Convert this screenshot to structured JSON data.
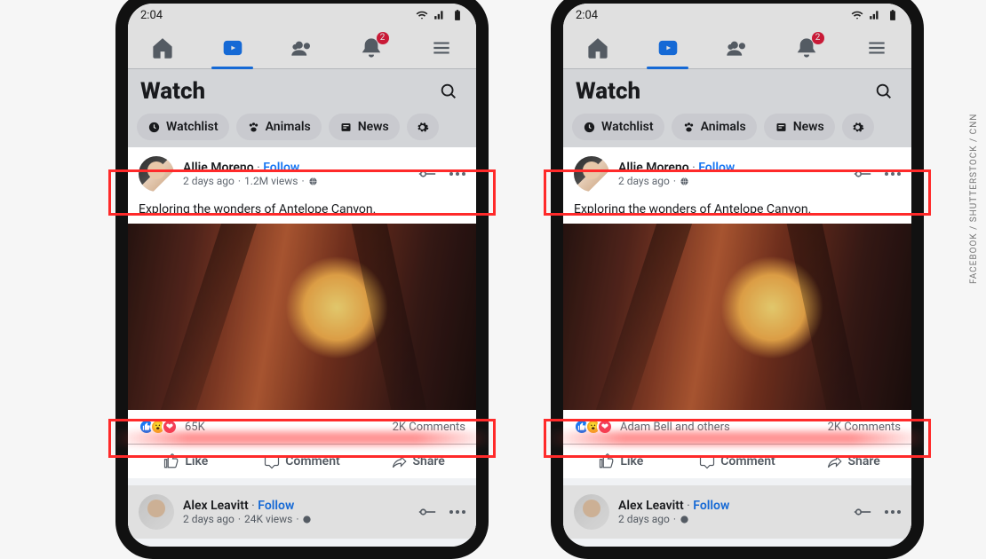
{
  "credit": "FACEBOOK / SHUTTERSTOCK / CNN",
  "status": {
    "time": "2:04"
  },
  "tabs": {
    "notification_badge": "2"
  },
  "header": {
    "title": "Watch"
  },
  "chips": {
    "watchlist": "Watchlist",
    "animals": "Animals",
    "news": "News"
  },
  "left": {
    "post": {
      "name": "Allie Moreno",
      "follow": "Follow",
      "sep": " · ",
      "time": "2 days ago",
      "views": "1.2M views",
      "caption": "Exploring the wonders of Antelope Canyon.",
      "reaction_text": "65K",
      "comments": "2K Comments"
    }
  },
  "right": {
    "post": {
      "name": "Allie Moreno",
      "follow": "Follow",
      "sep": " · ",
      "time": "2 days ago",
      "caption": "Exploring the wonders of Antelope Canyon.",
      "reaction_text": "Adam Bell and others",
      "comments": "2K Comments"
    }
  },
  "actions": {
    "like": "Like",
    "comment": "Comment",
    "share": "Share"
  },
  "post2": {
    "name": "Alex Leavitt",
    "follow": "Follow",
    "sep": " · ",
    "time": "2 days ago",
    "views": "24K views"
  }
}
